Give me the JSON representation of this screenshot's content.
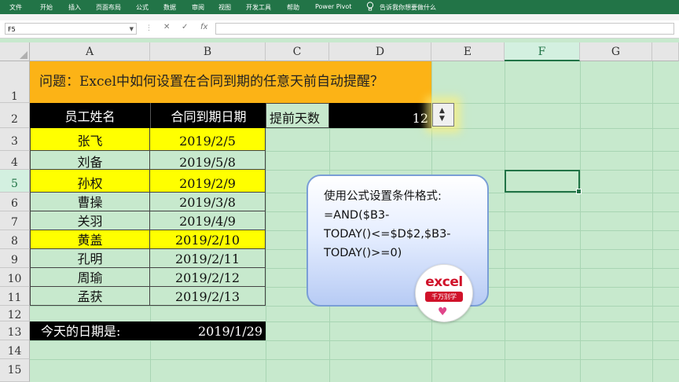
{
  "ribbon": {
    "tabs": [
      "文件",
      "开始",
      "插入",
      "页面布局",
      "公式",
      "数据",
      "审阅",
      "视图",
      "开发工具",
      "帮助",
      "Power Pivot"
    ],
    "tell_me": "告诉我你想要做什么"
  },
  "formula_bar": {
    "name_box": "F5",
    "cancel_glyph": "✕",
    "enter_glyph": "✓",
    "fx_label": "fx",
    "formula": ""
  },
  "columns": [
    "A",
    "B",
    "C",
    "D",
    "E",
    "F",
    "G"
  ],
  "selected_column": "F",
  "rows": [
    "1",
    "2",
    "3",
    "4",
    "5",
    "6",
    "7",
    "8",
    "9",
    "10",
    "11",
    "12",
    "13",
    "14",
    "15"
  ],
  "selected_row": "5",
  "sheet": {
    "title": "问题：Excel中如何设置在合同到期的任意天前自动提醒？",
    "header_name": "员工姓名",
    "header_date": "合同到期日期",
    "advance_label": "提前天数",
    "advance_value": "12",
    "employees": [
      {
        "name": "张飞",
        "date": "2019/2/5",
        "highlight": true
      },
      {
        "name": "刘备",
        "date": "2019/5/8",
        "highlight": false
      },
      {
        "name": "孙权",
        "date": "2019/2/9",
        "highlight": true
      },
      {
        "name": "曹操",
        "date": "2019/3/8",
        "highlight": false
      },
      {
        "name": "关羽",
        "date": "2019/4/9",
        "highlight": false
      },
      {
        "name": "黄盖",
        "date": "2019/2/10",
        "highlight": true
      },
      {
        "name": "孔明",
        "date": "2019/2/11",
        "highlight": false
      },
      {
        "name": "周瑜",
        "date": "2019/2/12",
        "highlight": false
      },
      {
        "name": "孟获",
        "date": "2019/2/13",
        "highlight": false
      }
    ],
    "today_label": "今天的日期是:",
    "today_value": "2019/1/29"
  },
  "callout": {
    "lines": [
      "使用公式设置条件格式:",
      "=AND($B3-",
      "TODAY()<=$D$2,$B3-",
      "TODAY()>=0)"
    ]
  },
  "badge": {
    "line1": "excel",
    "line2": "千万别学"
  },
  "colors": {
    "ribbon": "#227447",
    "highlight": "#ffff00",
    "title_bg": "#fcb316",
    "cell_bg": "#c7e9cd"
  }
}
